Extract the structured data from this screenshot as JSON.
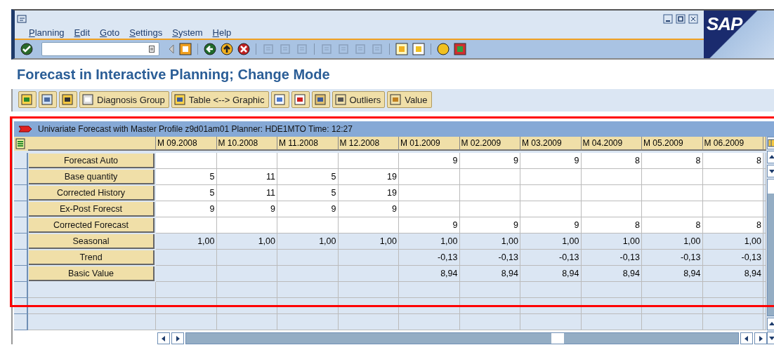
{
  "window": {
    "menu": [
      "Planning",
      "Edit",
      "Goto",
      "Settings",
      "System",
      "Help"
    ],
    "logo": "SAP"
  },
  "title": "Forecast in Interactive Planning; Change Mode",
  "app_toolbar": [
    {
      "kind": "icon"
    },
    {
      "kind": "icon"
    },
    {
      "kind": "icon"
    },
    {
      "kind": "text",
      "label": "Diagnosis Group"
    },
    {
      "kind": "text",
      "label": "Table <--> Graphic"
    },
    {
      "kind": "icon"
    },
    {
      "kind": "icon"
    },
    {
      "kind": "icon"
    },
    {
      "kind": "text",
      "label": "Outliers"
    },
    {
      "kind": "text",
      "label": "Value"
    }
  ],
  "grid": {
    "header": "Univariate Forecast with Master Profile z9d01am01 Planner: HDE1MTO Time: 12:27",
    "highlight_frame": true,
    "columns": [
      "M 09.2008",
      "M 10.2008",
      "M 11.2008",
      "M 12.2008",
      "M 01.2009",
      "M 02.2009",
      "M 03.2009",
      "M 04.2009",
      "M 05.2009",
      "M 06.2009"
    ],
    "rows": [
      {
        "label": "Forecast Auto",
        "shaded": false,
        "cells": [
          null,
          null,
          null,
          null,
          "9",
          "9",
          "9",
          "8",
          "8",
          "8"
        ]
      },
      {
        "label": "Base quantity",
        "shaded": false,
        "cells": [
          "5",
          "11",
          "5",
          "19",
          null,
          null,
          null,
          null,
          null,
          null
        ]
      },
      {
        "label": "Corrected History",
        "shaded": false,
        "cells": [
          "5",
          "11",
          "5",
          "19",
          null,
          null,
          null,
          null,
          null,
          null
        ]
      },
      {
        "label": "Ex-Post Forecst",
        "shaded": false,
        "cells": [
          "9",
          "9",
          "9",
          "9",
          null,
          null,
          null,
          null,
          null,
          null
        ]
      },
      {
        "label": "Corrected Forecast",
        "shaded": false,
        "cells": [
          null,
          null,
          null,
          null,
          "9",
          "9",
          "9",
          "8",
          "8",
          "8"
        ]
      },
      {
        "label": "Seasonal",
        "shaded": true,
        "cells": [
          "1,00",
          "1,00",
          "1,00",
          "1,00",
          "1,00",
          "1,00",
          "1,00",
          "1,00",
          "1,00",
          "1,00"
        ]
      },
      {
        "label": "Trend",
        "shaded": true,
        "cells": [
          null,
          null,
          null,
          null,
          "-0,13",
          "-0,13",
          "-0,13",
          "-0,13",
          "-0,13",
          "-0,13"
        ]
      },
      {
        "label": "Basic Value",
        "shaded": true,
        "cells": [
          null,
          null,
          null,
          null,
          "8,94",
          "8,94",
          "8,94",
          "8,94",
          "8,94",
          "8,94"
        ]
      }
    ]
  }
}
